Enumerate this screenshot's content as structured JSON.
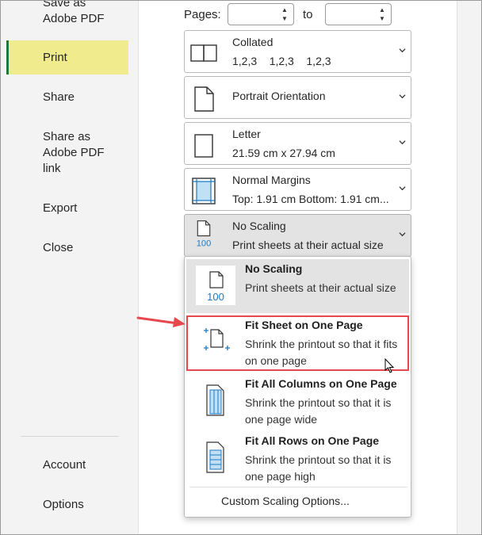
{
  "sidebar": {
    "items": [
      {
        "label": "Save as\nAdobe PDF"
      },
      {
        "label": "Print",
        "active": true
      },
      {
        "label": "Share"
      },
      {
        "label": "Share as\nAdobe PDF\nlink"
      },
      {
        "label": "Export"
      },
      {
        "label": "Close"
      }
    ],
    "bottom_items": [
      {
        "label": "Account"
      },
      {
        "label": "Options"
      }
    ]
  },
  "pages": {
    "label": "Pages:",
    "to_label": "to",
    "from_value": "",
    "to_value": ""
  },
  "settings": [
    {
      "line1": "Collated",
      "line2": "1,2,3    1,2,3    1,2,3",
      "icon": "collated-icon"
    },
    {
      "line1": "Portrait Orientation",
      "line2": "",
      "icon": "portrait-page-icon"
    },
    {
      "line1": "Letter",
      "line2": "21.59 cm x 27.94 cm",
      "icon": "letter-page-icon"
    },
    {
      "line1": "Normal Margins",
      "line2": "Top: 1.91 cm Bottom: 1.91 cm...",
      "icon": "margins-icon"
    },
    {
      "line1": "No Scaling",
      "line2": "Print sheets at their actual size",
      "icon": "no-scaling-icon",
      "tile_label": "100"
    }
  ],
  "scaling_options": [
    {
      "title": "No Scaling",
      "desc": "Print sheets at their actual size",
      "icon": "no-scaling-icon",
      "tile_label": "100"
    },
    {
      "title": "Fit Sheet on One Page",
      "desc": "Shrink the printout so that it fits on one page",
      "icon": "fit-sheet-icon"
    },
    {
      "title": "Fit All Columns on One Page",
      "desc": "Shrink the printout so that it is one page wide",
      "icon": "fit-columns-icon"
    },
    {
      "title": "Fit All Rows on One Page",
      "desc": "Shrink the printout so that it is one page high",
      "icon": "fit-rows-icon"
    }
  ],
  "custom_scaling_label": "Custom Scaling Options...",
  "colors": {
    "active_nav_bg": "#f0ec8e",
    "active_nav_accent": "#217346",
    "highlight_border": "#e5484d",
    "annotation_arrow": "#e5484d",
    "icon_blue": "#1f7ac2"
  }
}
